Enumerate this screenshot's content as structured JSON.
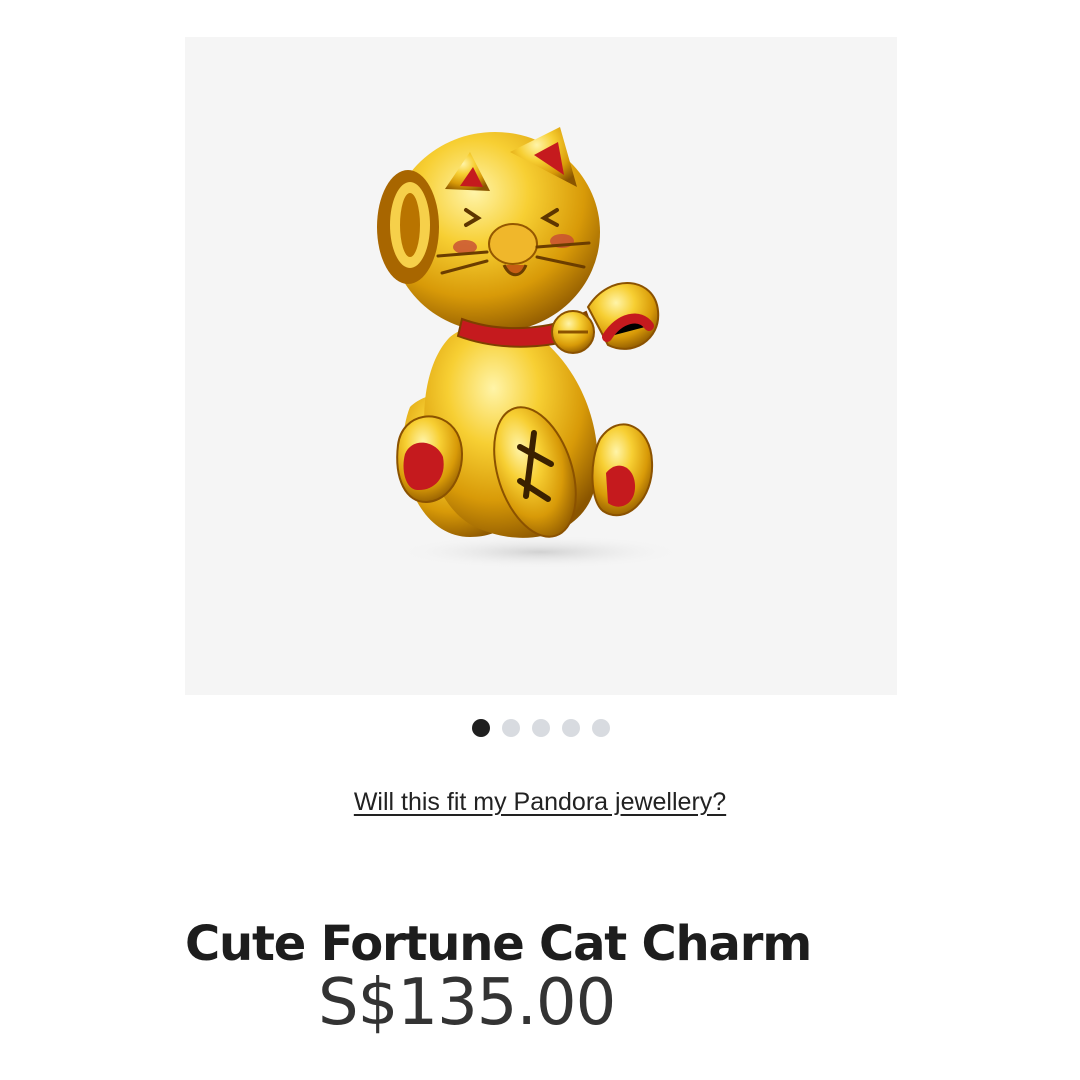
{
  "gallery": {
    "image_alt": "Cute Fortune Cat Charm",
    "next_icon": "chevron-right-icon",
    "slides_total": 5,
    "active_slide": 1
  },
  "links": {
    "fit_question": "Will this fit my Pandora jewellery?"
  },
  "product": {
    "title": "Cute Fortune Cat Charm",
    "price": "S$135.00"
  },
  "colors": {
    "gallery_background": "#f5f5f5",
    "gold": "#e2a90f",
    "enamel_red": "#b8161b",
    "active_dot": "#1f1f1f",
    "inactive_dot": "#d8dbe0"
  }
}
